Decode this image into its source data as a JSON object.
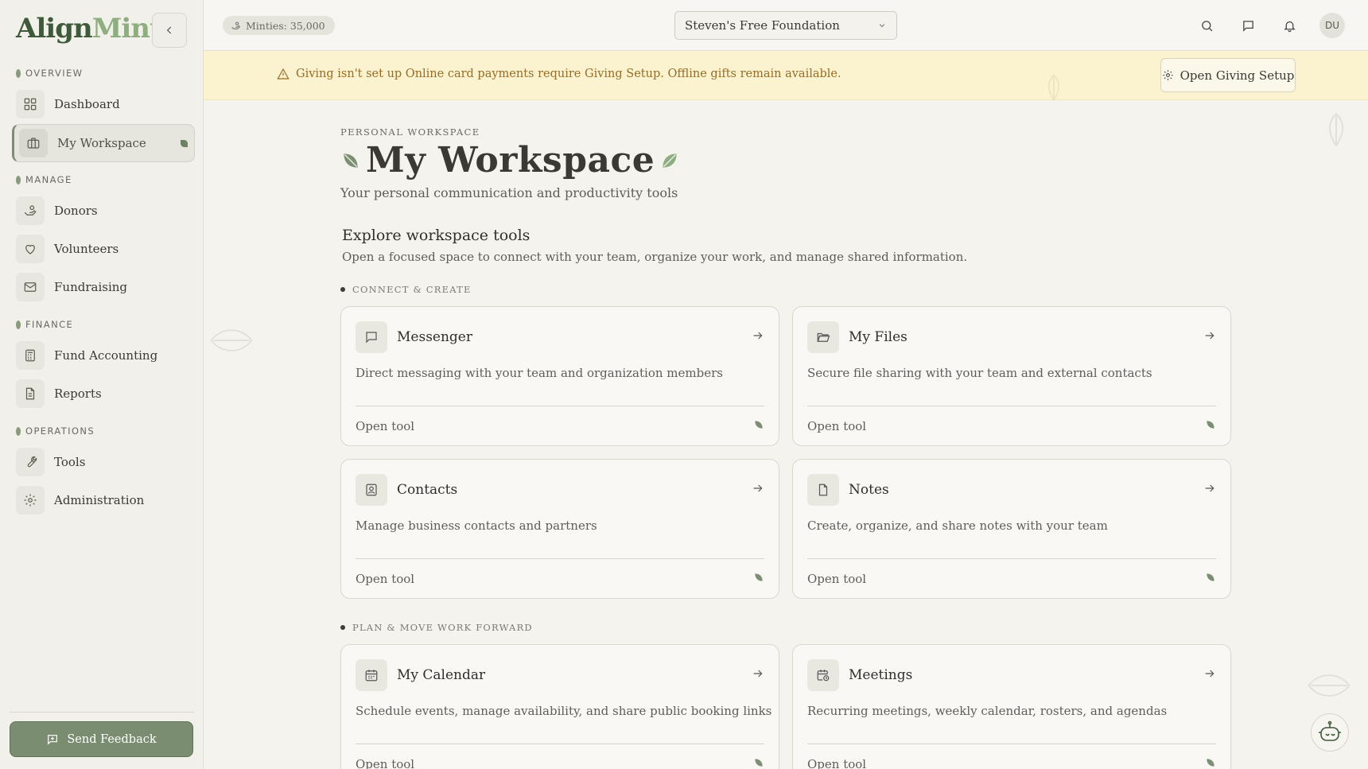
{
  "app": {
    "logo_part1": "Align",
    "logo_part2": "Mint",
    "brand_color": "#3f5a3a",
    "accent_color": "#7a8d70"
  },
  "sidebar": {
    "sections": [
      {
        "label": "OVERVIEW"
      },
      {
        "label": "MANAGE"
      },
      {
        "label": "FINANCE"
      },
      {
        "label": "OPERATIONS"
      }
    ],
    "items": [
      {
        "label": "Dashboard",
        "icon": "grid-icon"
      },
      {
        "label": "My Workspace",
        "icon": "briefcase-icon",
        "active": true
      },
      {
        "label": "Donors",
        "icon": "hand-coins-icon"
      },
      {
        "label": "Volunteers",
        "icon": "heart-icon"
      },
      {
        "label": "Fundraising",
        "icon": "mail-icon"
      },
      {
        "label": "Fund Accounting",
        "icon": "calculator-icon"
      },
      {
        "label": "Reports",
        "icon": "file-text-icon"
      },
      {
        "label": "Tools",
        "icon": "wrench-icon"
      },
      {
        "label": "Administration",
        "icon": "gear-icon"
      }
    ],
    "feedback_label": "Send Feedback"
  },
  "topbar": {
    "minties_label": "Minties: 35,000",
    "org_selected": "Steven's Free Foundation",
    "avatar_initials": "DU"
  },
  "banner": {
    "message": "Giving isn't set up Online card payments require Giving Setup. Offline gifts remain available.",
    "button_label": "Open Giving Setup",
    "text_color": "#9a6b22",
    "bg_color": "#fbf3cf"
  },
  "main": {
    "eyebrow": "PERSONAL WORKSPACE",
    "title": "My Workspace",
    "subtitle": "Your personal communication and productivity tools",
    "explore_title": "Explore workspace tools",
    "explore_sub": "Open a focused space to connect with your team, organize your work, and manage shared information.",
    "groups": [
      {
        "label": "CONNECT & CREATE"
      },
      {
        "label": "PLAN & MOVE WORK FORWARD"
      }
    ],
    "cards": [
      {
        "title": "Messenger",
        "desc": "Direct messaging with your team and organization members",
        "open": "Open tool",
        "icon": "message-square-icon"
      },
      {
        "title": "My Files",
        "desc": "Secure file sharing with your team and external contacts",
        "open": "Open tool",
        "icon": "folder-open-icon"
      },
      {
        "title": "Contacts",
        "desc": "Manage business contacts and partners",
        "open": "Open tool",
        "icon": "contact-card-icon"
      },
      {
        "title": "Notes",
        "desc": "Create, organize, and share notes with your team",
        "open": "Open tool",
        "icon": "note-icon"
      },
      {
        "title": "My Calendar",
        "desc": "Schedule events, manage availability, and share public booking links",
        "open": "Open tool",
        "icon": "calendar-icon"
      },
      {
        "title": "Meetings",
        "desc": "Recurring meetings, weekly calendar, rosters, and agendas",
        "open": "Open tool",
        "icon": "calendar-clock-icon"
      }
    ]
  }
}
